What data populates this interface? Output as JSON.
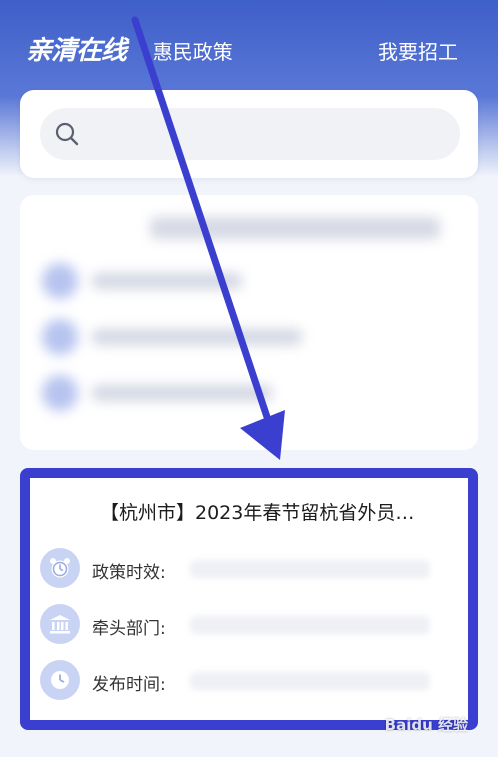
{
  "header": {
    "logo": "亲清在线",
    "subtitle": "· 惠民政策",
    "recruit_link": "我要招工"
  },
  "search": {
    "placeholder": ""
  },
  "policy": {
    "title": "【杭州市】2023年春节留杭省外员…",
    "rows": [
      {
        "label": "政策时效:",
        "icon": "alarm-clock-icon"
      },
      {
        "label": "牵头部门:",
        "icon": "government-building-icon"
      },
      {
        "label": "发布时间:",
        "icon": "clock-icon"
      }
    ]
  },
  "watermark": "Baidu 经验",
  "colors": {
    "header_blue": "#3f5fc9",
    "annotation": "#3a3fcf",
    "icon_bg": "#c9d3f4"
  }
}
